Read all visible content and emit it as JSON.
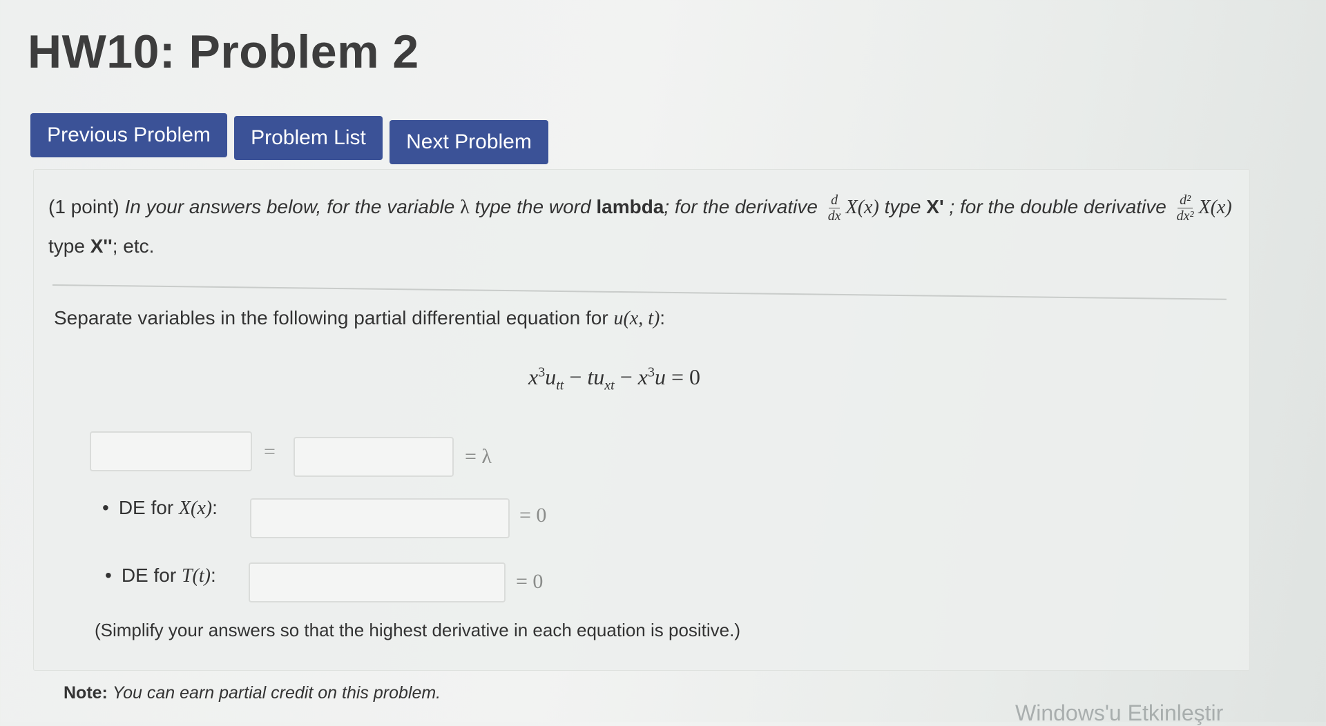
{
  "page": {
    "title": "HW10: Problem 2"
  },
  "nav": {
    "prev_label": "Previous Problem",
    "list_label": "Problem List",
    "next_label": "Next Problem"
  },
  "intro": {
    "points": "(1 point)",
    "text1": "In your answers below, for the variable",
    "lambda_symbol": "λ",
    "text2": "type the word",
    "word_lambda": "lambda",
    "text3": "; for the derivative",
    "deriv_num": "d",
    "deriv_den": "dx",
    "X_of_x": "X(x)",
    "text4": "type",
    "X_prime": "X'",
    "text5": "; for the double derivative",
    "dderiv_num": "d²",
    "dderiv_den": "dx²",
    "X_of_x_2": "X(x)",
    "text6": "type",
    "X_double_prime": "X''",
    "text7": "; etc."
  },
  "prompt": {
    "text": "Separate variables in the following partial differential equation for",
    "func": "u(x, t)",
    "colon": ":"
  },
  "equation": {
    "t1_base": "x",
    "t1_exp": "3",
    "t1_var": "u",
    "t1_sub": "tt",
    "minus1": " − ",
    "t2_var": "tu",
    "t2_sub": "xt",
    "minus2": " − ",
    "t3_base": "x",
    "t3_exp": "3",
    "t3_var": "u",
    "rhs": " = 0"
  },
  "separation": {
    "equals": "=",
    "equals_lambda": "= λ",
    "left_value": "",
    "right_value": ""
  },
  "de_x": {
    "bullet": "•",
    "label": "DE for",
    "func": "X(x)",
    "colon": ":",
    "value": "",
    "rhs": "= 0"
  },
  "de_t": {
    "bullet": "•",
    "label": "DE for",
    "func": "T(t)",
    "colon": ":",
    "value": "",
    "rhs": "= 0"
  },
  "simplify_text": "(Simplify your answers so that the highest derivative in each equation is positive.)",
  "note": {
    "label": "Note:",
    "text": "You can earn partial credit on this problem."
  },
  "watermark": "Windows'u Etkinleştir"
}
